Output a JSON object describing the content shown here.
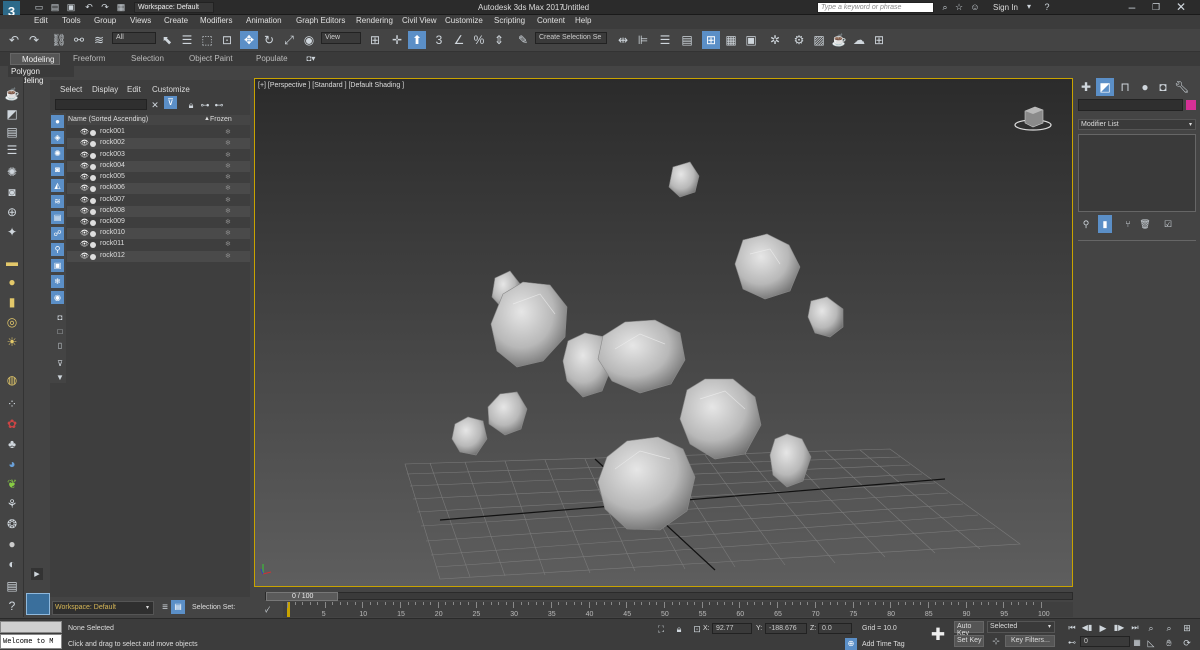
{
  "titlebar": {
    "workspace": "Workspace: Default",
    "app_title": "Autodesk 3ds Max 2017",
    "doc_title": "Untitled",
    "search_placeholder": "Type a keyword or phrase",
    "sign_in": "Sign In"
  },
  "menu": [
    "Edit",
    "Tools",
    "Group",
    "Views",
    "Create",
    "Modifiers",
    "Animation",
    "Graph Editors",
    "Rendering",
    "Civil View",
    "Customize",
    "Scripting",
    "Content",
    "Help"
  ],
  "toolbar": {
    "filter_value": "All",
    "view_value": "View",
    "selection_set": "Create Selection Se"
  },
  "ribbon": {
    "tabs": [
      "Modeling",
      "Freeform",
      "Selection",
      "Object Paint",
      "Populate"
    ],
    "sub_label": "Polygon Modeling"
  },
  "explorer": {
    "menu": [
      "Select",
      "Display",
      "Edit",
      "Customize"
    ],
    "col_name": "Name (Sorted Ascending)",
    "col_frozen": "Frozen",
    "objects": [
      "rock001",
      "rock002",
      "rock003",
      "rock004",
      "rock005",
      "rock006",
      "rock007",
      "rock008",
      "rock009",
      "rock010",
      "rock011",
      "rock012"
    ],
    "workspace": "Workspace: Default",
    "selection_set": "Selection Set:"
  },
  "viewport": {
    "label": "[+] [Perspective ] [Standard ] [Default Shading ]"
  },
  "rightpanel": {
    "modifier_list": "Modifier List"
  },
  "timeline": {
    "frame": "0 / 100",
    "ticks": [
      "0",
      "5",
      "10",
      "15",
      "20",
      "25",
      "30",
      "35",
      "40",
      "45",
      "50",
      "55",
      "60",
      "65",
      "70",
      "75",
      "80",
      "85",
      "90",
      "95",
      "100"
    ]
  },
  "status": {
    "listener": "Welcome to M",
    "selected": "None Selected",
    "prompt": "Click and drag to select and move objects",
    "x_label": "X:",
    "x_value": "92.77",
    "y_label": "Y:",
    "y_value": "-188.676",
    "z_label": "Z:",
    "z_value": "0.0",
    "grid": "Grid = 10.0",
    "add_time_tag": "Add Time Tag",
    "auto_key": "Auto Key",
    "set_key": "Set Key",
    "selected_dropdown": "Selected",
    "key_filters": "Key Filters...",
    "frame_value": "0"
  },
  "colors": {
    "accent": "#c8a300",
    "active": "#5b8fc7",
    "swatch": "#d63096"
  }
}
